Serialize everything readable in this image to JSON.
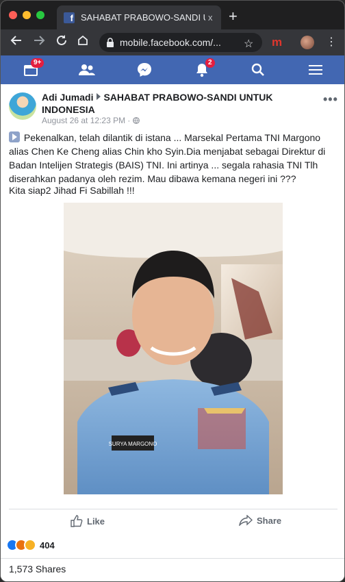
{
  "browser": {
    "tab_title": "SAHABAT PRABOWO-SANDI U",
    "tab_close": "x",
    "new_tab": "+",
    "url": "mobile.facebook.com/...",
    "extension_label": "m"
  },
  "fbnav": {
    "home_badge": "9+",
    "notifications_badge": "2",
    "accent": "#4267b2"
  },
  "post": {
    "author": "Adi Jumadi",
    "group": "SAHABAT PRABOWO-SANDI UNTUK INDONESIA",
    "meta": "August 26 at 12:23 PM · ",
    "body": "Pekenalkan, telah dilantik di istana ... Marsekal Pertama TNI Margono alias Chen Ke Cheng alias Chin kho Syin.Dia menjabat sebagai Direktur di Badan Intelijen Strategis (BAIS) TNI. Ini artinya ... segala rahasia TNI Tlh diserahkan padanya oleh rezim. Mau dibawa kemana negeri ini ???",
    "body2": "Kita siap2 Jihad Fi Sabillah !!!",
    "name_tag": "SURYA MARGONO"
  },
  "actions": {
    "like_label": "Like",
    "share_label": "Share"
  },
  "stats": {
    "reactions_count": "404",
    "shares_text": "1,573 Shares"
  },
  "icons": [
    "facebook-favicon",
    "back-icon",
    "forward-icon",
    "reload-icon",
    "home-icon",
    "lock-icon",
    "star-icon",
    "profile-avatar-icon",
    "menu-icon",
    "feed-icon",
    "friends-icon",
    "messenger-icon",
    "bell-icon",
    "search-icon",
    "hamburger-icon",
    "globe-icon",
    "more-icon",
    "thumbs-up-icon",
    "share-arrow-icon",
    "like-reaction-icon",
    "angry-reaction-icon",
    "wow-reaction-icon"
  ]
}
